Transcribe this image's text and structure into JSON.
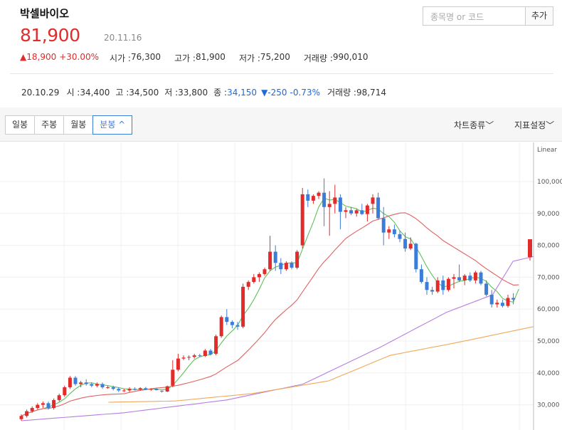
{
  "stock": {
    "name": "박셀바이오",
    "price": "81,900",
    "date": "20.11.16"
  },
  "search": {
    "placeholder": "종목명 or 코드",
    "button": "추가"
  },
  "summary": {
    "change": "▲18,900",
    "change_pct": "+30.00%",
    "open_label": "시가 : ",
    "open": "76,300",
    "high_label": "고가 : ",
    "high": "81,900",
    "low_label": "저가 : ",
    "low": "75,200",
    "volume_label": "거래량 : ",
    "volume": "990,010"
  },
  "hover": {
    "date": "20.10.29",
    "open_label": "시 : ",
    "open": "34,400",
    "high_label": "고 : ",
    "high": "34,500",
    "low_label": "저 : ",
    "low": "33,800",
    "close_label": "종 : ",
    "close": "34,150",
    "change": "▼-250",
    "change_pct": "-0.73%",
    "volume_label": "거래량 : ",
    "volume": "98,714"
  },
  "tabs": [
    "일봉",
    "주봉",
    "월봉",
    "분봉 ^"
  ],
  "options": {
    "chart_type": "차트종류﹀",
    "indicator": "지표설정﹀"
  },
  "colors": {
    "up": "#e22b2b",
    "down": "#3b7dd8",
    "ma5": "#5fc15f",
    "ma20": "#e06262",
    "ma60": "#b57ee0",
    "ma120": "#f0a95a"
  },
  "chart_data": {
    "type": "candlestick",
    "scale_label": "Linear",
    "y_ticks": [
      "100,000",
      "90,000",
      "80,000",
      "70,000",
      "60,000",
      "50,000",
      "40,000",
      "30,000"
    ],
    "ylim": [
      25000,
      104000
    ],
    "candles": [
      [
        25500,
        27000,
        25000,
        26500
      ],
      [
        26500,
        28500,
        26000,
        28000
      ],
      [
        28000,
        29500,
        27500,
        29000
      ],
      [
        29000,
        30500,
        28500,
        30000
      ],
      [
        30000,
        31000,
        29000,
        30500
      ],
      [
        30500,
        31000,
        28500,
        29000
      ],
      [
        29000,
        32000,
        28500,
        31500
      ],
      [
        31500,
        33500,
        31000,
        33000
      ],
      [
        33000,
        36000,
        32500,
        35500
      ],
      [
        35500,
        39000,
        35000,
        38500
      ],
      [
        38500,
        39000,
        36000,
        36500
      ],
      [
        36500,
        37500,
        35500,
        37000
      ],
      [
        37000,
        38000,
        36000,
        36500
      ],
      [
        36500,
        37000,
        35500,
        36000
      ],
      [
        36000,
        37000,
        35500,
        36500
      ],
      [
        36500,
        37000,
        35000,
        35500
      ],
      [
        35500,
        36000,
        35000,
        35500
      ],
      [
        35500,
        36000,
        34500,
        35000
      ],
      [
        35000,
        35500,
        34000,
        34500
      ],
      [
        34500,
        35000,
        34000,
        34500
      ],
      [
        34500,
        35500,
        34000,
        35000
      ],
      [
        35000,
        35500,
        34500,
        34800
      ],
      [
        34800,
        35500,
        34500,
        35200
      ],
      [
        35200,
        35600,
        34600,
        34800
      ],
      [
        34800,
        35200,
        34400,
        35000
      ],
      [
        35000,
        35300,
        34500,
        34600
      ],
      [
        34400,
        34500,
        33800,
        34150
      ],
      [
        34150,
        36000,
        34000,
        35800
      ],
      [
        36000,
        44000,
        35500,
        41000
      ],
      [
        41000,
        46000,
        40500,
        44500
      ],
      [
        44500,
        45500,
        44000,
        44800
      ],
      [
        44800,
        45500,
        44000,
        45000
      ],
      [
        45000,
        46000,
        44500,
        45500
      ],
      [
        45500,
        46000,
        45000,
        45300
      ],
      [
        45300,
        47500,
        45000,
        47000
      ],
      [
        47000,
        47500,
        45500,
        45800
      ],
      [
        46000,
        52000,
        45500,
        51500
      ],
      [
        51500,
        58000,
        51000,
        57500
      ],
      [
        57500,
        60000,
        55000,
        56000
      ],
      [
        56000,
        56500,
        54000,
        55000
      ],
      [
        55000,
        56000,
        53500,
        54500
      ],
      [
        54500,
        68000,
        54000,
        67000
      ],
      [
        67000,
        69000,
        66000,
        68500
      ],
      [
        68500,
        71000,
        68000,
        70000
      ],
      [
        70000,
        71500,
        68500,
        71000
      ],
      [
        71000,
        73000,
        70500,
        72500
      ],
      [
        72500,
        83000,
        72000,
        78000
      ],
      [
        78000,
        80000,
        72000,
        74500
      ],
      [
        74500,
        76000,
        71000,
        72500
      ],
      [
        72500,
        75000,
        72000,
        74500
      ],
      [
        74500,
        75000,
        72500,
        73000
      ],
      [
        73000,
        78500,
        72500,
        78000
      ],
      [
        80000,
        98000,
        79000,
        96000
      ],
      [
        96000,
        97500,
        92000,
        94000
      ],
      [
        94000,
        96000,
        93000,
        95500
      ],
      [
        95500,
        97000,
        94500,
        96500
      ],
      [
        96500,
        101000,
        86000,
        92000
      ],
      [
        92000,
        97000,
        83000,
        93000
      ],
      [
        93000,
        99000,
        90000,
        95000
      ],
      [
        95000,
        96000,
        85000,
        90500
      ],
      [
        90500,
        92000,
        88500,
        91000
      ],
      [
        91000,
        92000,
        89500,
        90000
      ],
      [
        90000,
        91500,
        89000,
        91000
      ],
      [
        91000,
        93000,
        89500,
        89800
      ],
      [
        89800,
        93000,
        87500,
        92500
      ],
      [
        93000,
        96000,
        90000,
        95000
      ],
      [
        95000,
        96500,
        88000,
        88500
      ],
      [
        88500,
        92000,
        80000,
        84000
      ],
      [
        84000,
        86000,
        82000,
        85000
      ],
      [
        85000,
        86500,
        82500,
        83500
      ],
      [
        83500,
        84500,
        81000,
        82000
      ],
      [
        82000,
        84000,
        78000,
        79000
      ],
      [
        79000,
        82500,
        78500,
        80500
      ],
      [
        80500,
        80800,
        71500,
        72500
      ],
      [
        72500,
        74000,
        68000,
        68500
      ],
      [
        68500,
        70000,
        64500,
        66000
      ],
      [
        66000,
        67000,
        64500,
        65500
      ],
      [
        65500,
        70000,
        65000,
        69000
      ],
      [
        69000,
        70500,
        64500,
        66000
      ],
      [
        66000,
        70000,
        65500,
        69500
      ],
      [
        69500,
        71000,
        66500,
        70000
      ],
      [
        70000,
        74000,
        68500,
        69000
      ],
      [
        69000,
        71000,
        67500,
        70500
      ],
      [
        70500,
        71500,
        68500,
        69000
      ],
      [
        69000,
        72000,
        68000,
        71500
      ],
      [
        71500,
        72000,
        67500,
        68000
      ],
      [
        68000,
        69000,
        64000,
        64500
      ],
      [
        64500,
        66000,
        60500,
        61500
      ],
      [
        61500,
        63000,
        60500,
        62000
      ],
      [
        62000,
        63000,
        60500,
        61000
      ],
      [
        61000,
        64500,
        60500,
        63500
      ],
      [
        63500,
        65000,
        61500,
        63000
      ],
      [
        76300,
        81900,
        75200,
        81900
      ]
    ]
  }
}
